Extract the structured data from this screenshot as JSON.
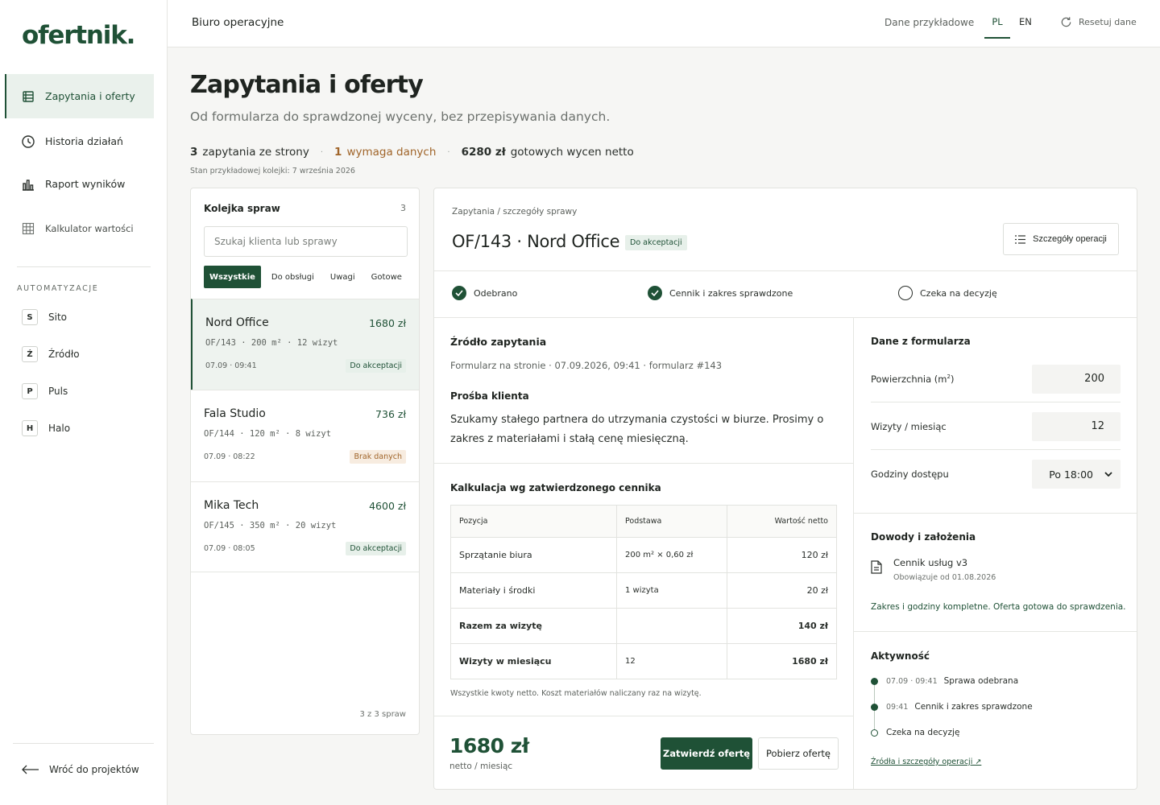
{
  "app": {
    "logo": "ofertnik."
  },
  "sidebar": {
    "nav": [
      {
        "label": "Zapytania i oferty",
        "icon": "list-icon",
        "active": true
      },
      {
        "label": "Historia działań",
        "icon": "clock-icon",
        "active": false
      },
      {
        "label": "Raport wyników",
        "icon": "bar-chart-icon",
        "active": false
      },
      {
        "label": "Kalkulator wartości",
        "icon": "grid-icon",
        "active": false
      }
    ],
    "section_label": "AUTOMATYZACJE",
    "automations": [
      {
        "badge": "S",
        "label": "Sito"
      },
      {
        "badge": "Ź",
        "label": "Źródło"
      },
      {
        "badge": "P",
        "label": "Puls"
      },
      {
        "badge": "H",
        "label": "Halo"
      }
    ],
    "back_label": "Wróć do projektów"
  },
  "topbar": {
    "breadcrumb": "Biuro operacyjne",
    "sample_data": "Dane przykładowe",
    "lang_pl": "PL",
    "lang_en": "EN",
    "reset": "Resetuj dane"
  },
  "header": {
    "title": "Zapytania i oferty",
    "subtitle": "Od formularza do sprawdzonej wyceny, bez przepisywania danych.",
    "stats": {
      "inquiries_count": "3",
      "inquiries_label": "zapytania ze strony",
      "needs_data_count": "1",
      "needs_data_label": "wymaga danych",
      "ready_amount": "6280 zł",
      "ready_label": "gotowych wycen netto"
    },
    "note": "Stan przykładowej kolejki: 7 września 2026"
  },
  "queue": {
    "title": "Kolejka spraw",
    "count": "3",
    "search_placeholder": "Szukaj klienta lub sprawy",
    "filters": [
      {
        "label": "Wszystkie",
        "active": true
      },
      {
        "label": "Do obsługi",
        "active": false
      },
      {
        "label": "Uwagi",
        "active": false
      },
      {
        "label": "Gotowe",
        "active": false
      }
    ],
    "cases": [
      {
        "name": "Nord Office",
        "amount": "1680 zł",
        "meta": "OF/143 · 200 m² · 12 wizyt",
        "time": "07.09 · 09:41",
        "badge": "Do akceptacji",
        "badge_type": "ok",
        "active": true
      },
      {
        "name": "Fala Studio",
        "amount": "736 zł",
        "meta": "OF/144 · 120 m² · 8 wizyt",
        "time": "07.09 · 08:22",
        "badge": "Brak danych",
        "badge_type": "warn",
        "active": false
      },
      {
        "name": "Mika Tech",
        "amount": "4600 zł",
        "meta": "OF/145 · 350 m² · 20 wizyt",
        "time": "07.09 · 08:05",
        "badge": "Do akceptacji",
        "badge_type": "ok",
        "active": false
      }
    ],
    "footer": "3 z 3 spraw"
  },
  "detail": {
    "breadcrumb": "Zapytania / szczegóły sprawy",
    "title": "OF/143 · Nord Office",
    "status": "Do akceptacji",
    "ops_button": "Szczegóły operacji",
    "steps": [
      {
        "label": "Odebrano",
        "done": true
      },
      {
        "label": "Cennik i zakres sprawdzone",
        "done": true
      },
      {
        "label": "Czeka na decyzję",
        "done": false
      }
    ],
    "source": {
      "title": "Źródło zapytania",
      "text": "Formularz na stronie · 07.09.2026, 09:41 · formularz #143"
    },
    "request": {
      "title": "Prośba klienta",
      "text": "Szukamy stałego partnera do utrzymania czystości w biurze. Prosimy o zakres z materiałami i stałą cenę miesięczną."
    },
    "calc": {
      "title": "Kalkulacja wg zatwierdzonego cennika",
      "headers": [
        "Pozycja",
        "Podstawa",
        "Wartość netto"
      ],
      "rows": [
        {
          "item": "Sprzątanie biura",
          "base": "200 m² × 0,60 zł",
          "value": "120 zł",
          "bold": false
        },
        {
          "item": "Materiały i środki",
          "base": "1 wizyta",
          "value": "20 zł",
          "bold": false
        },
        {
          "item": "Razem za wizytę",
          "base": "",
          "value": "140 zł",
          "bold": true
        },
        {
          "item": "Wizyty w miesiącu",
          "base": "12",
          "value": "1680 zł",
          "bold": true
        }
      ],
      "note": "Wszystkie kwoty netto. Koszt materiałów naliczany raz na wizytę."
    },
    "total": "1680 zł",
    "total_sub": "netto / miesiąc",
    "approve_button": "Zatwierdź ofertę",
    "download_button": "Pobierz ofertę",
    "form": {
      "title": "Dane z formularza",
      "area_label": "Powierzchnia (m",
      "area_sup": "2",
      "area_label_end": ")",
      "area_value": "200",
      "visits_label": "Wizyty / miesiąc",
      "visits_value": "12",
      "hours_label": "Godziny dostępu",
      "hours_value": "Po 18:00"
    },
    "evidence": {
      "title": "Dowody i założenia",
      "doc_name": "Cennik usług v3",
      "doc_sub": "Obowiązuje od 01.08.2026",
      "note": "Zakres i godziny kompletne. Oferta gotowa do sprawdzenia."
    },
    "activity": {
      "title": "Aktywność",
      "items": [
        {
          "time": "07.09 · 09:41",
          "label": "Sprawa odebrana",
          "done": true
        },
        {
          "time": "09:41",
          "label": "Cennik i zakres sprawdzone",
          "done": true
        },
        {
          "time": "",
          "label": "Czeka na decyzję",
          "done": false
        }
      ],
      "link": "Źródła i szczegóły operacji ↗"
    }
  },
  "colors": {
    "brand": "#1f5136",
    "warn": "#a0652a",
    "bg": "#f6f6f4"
  }
}
